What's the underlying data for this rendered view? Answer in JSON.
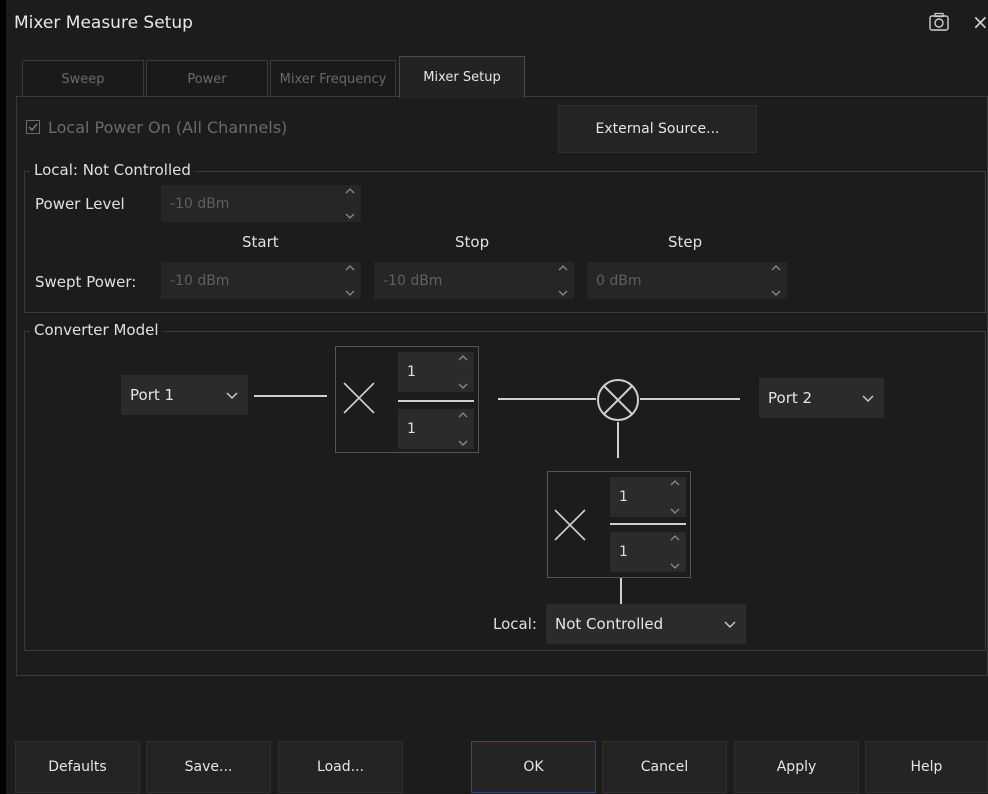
{
  "window": {
    "title": "Mixer Measure Setup",
    "close": "×"
  },
  "tabs": [
    {
      "label": "Sweep"
    },
    {
      "label": "Power"
    },
    {
      "label": "Mixer Frequency"
    },
    {
      "label": "Mixer Setup"
    }
  ],
  "local_power": {
    "label": "Local Power On (All Channels)",
    "checked": true
  },
  "external_source_button": "External Source...",
  "local_group": {
    "title": "Local: Not Controlled",
    "power_level_label": "Power Level",
    "power_level_value": "-10 dBm",
    "col_start": "Start",
    "col_stop": "Stop",
    "col_step": "Step",
    "swept_label": "Swept Power:",
    "swept_start": "-10 dBm",
    "swept_stop": "-10 dBm",
    "swept_step": "0 dBm"
  },
  "converter": {
    "title": "Converter Model",
    "input_port": "Port 1",
    "output_port": "Port 2",
    "input_multiplier": {
      "numerator": "1",
      "denominator": "1"
    },
    "local_multiplier": {
      "numerator": "1",
      "denominator": "1"
    },
    "local_label": "Local:",
    "local_value": "Not Controlled"
  },
  "footer": {
    "defaults": "Defaults",
    "save": "Save...",
    "load": "Load...",
    "ok": "OK",
    "cancel": "Cancel",
    "apply": "Apply",
    "help": "Help"
  }
}
